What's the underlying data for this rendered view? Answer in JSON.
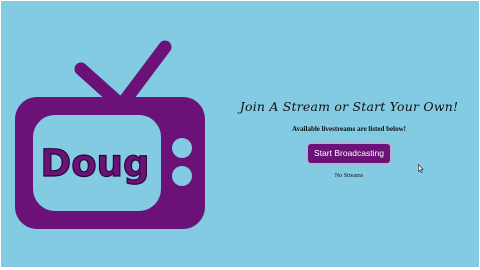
{
  "logo": {
    "text": "Doug",
    "icon": "tv-icon",
    "color": "#6b1178"
  },
  "main": {
    "headline": "Join A Stream or Start Your Own!",
    "subtitle": "Available livestreams are listed below!",
    "start_button_label": "Start Broadcasting",
    "status_text": "No Streams"
  },
  "colors": {
    "background": "#82cbe2",
    "accent": "#6b1178"
  },
  "cursor": {
    "icon": "mouse-pointer-icon"
  }
}
